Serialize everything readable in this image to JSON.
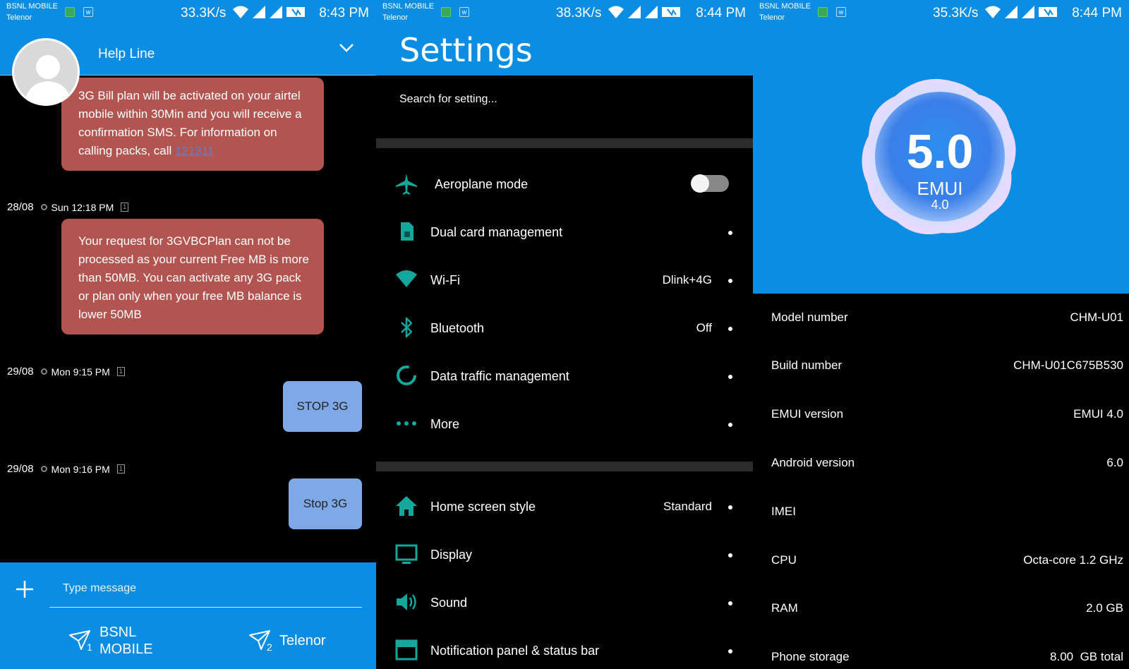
{
  "status_bars": [
    {
      "carrier1": "BSNL MOBILE",
      "carrier2": "Telenor",
      "speed": "33.3K/s",
      "time": "8:43 PM"
    },
    {
      "carrier1": "BSNL MOBILE",
      "carrier2": "Telenor",
      "speed": "38.3K/s",
      "time": "8:44 PM"
    },
    {
      "carrier1": "BSNL MOBILE",
      "carrier2": "Telenor",
      "speed": "35.3K/s",
      "time": "8:44 PM"
    }
  ],
  "chat": {
    "title": "Help Line",
    "messages": [
      {
        "text_before": "3G Bill plan will be activated on your airtel mobile within 30Min and you will receive a confirmation SMS. For information on calling packs, call ",
        "link": "121311"
      },
      {
        "text": "Your request for 3GVBCPlan can not be processed as your current Free MB is more than 50MB. You can activate any 3G pack or plan only when your free MB balance is lower 50MB"
      }
    ],
    "timestamps": [
      {
        "date": "28/08",
        "time": "Sun 12:18 PM",
        "sim": "1"
      },
      {
        "date": "29/08",
        "time": "Mon 9:15 PM",
        "sim": "1"
      },
      {
        "date": "29/08",
        "time": "Mon 9:16 PM",
        "sim": "1"
      }
    ],
    "sent": [
      "STOP 3G",
      "Stop 3G"
    ],
    "compose": {
      "placeholder": "Type message",
      "send1_sim": "1",
      "send1_label_line1": "BSNL",
      "send1_label_line2": "MOBILE",
      "send2_sim": "2",
      "send2_label": "Telenor"
    }
  },
  "settings": {
    "title": "Settings",
    "search_placeholder": "Search for setting...",
    "items": [
      {
        "label": "Aeroplane mode",
        "value": "",
        "icon": "airplane-icon"
      },
      {
        "label": "Dual card management",
        "value": "",
        "icon": "sim-card-icon"
      },
      {
        "label": "Wi-Fi",
        "value": "Dlink+4G",
        "icon": "wifi-icon"
      },
      {
        "label": "Bluetooth",
        "value": "Off",
        "icon": "bluetooth-icon"
      },
      {
        "label": "Data traffic management",
        "value": "",
        "icon": "data-usage-icon"
      },
      {
        "label": "More",
        "value": "",
        "icon": "more-dots-icon"
      },
      {
        "label": "Home screen style",
        "value": "Standard",
        "icon": "home-icon"
      },
      {
        "label": "Display",
        "value": "",
        "icon": "display-icon"
      },
      {
        "label": "Sound",
        "value": "",
        "icon": "speaker-icon"
      },
      {
        "label": "Notification panel & status bar",
        "value": "",
        "icon": "notification-panel-icon"
      }
    ],
    "accent": "#13a89e"
  },
  "about": {
    "logo_version": "5.0",
    "logo_brand": "EMUI",
    "logo_sub": "4.0",
    "rows": [
      {
        "label": "Model number",
        "value": "CHM-U01"
      },
      {
        "label": "Build number",
        "value": "CHM-U01C675B530"
      },
      {
        "label": "EMUI version",
        "value": "EMUI 4.0"
      },
      {
        "label": "Android version",
        "value": "6.0"
      },
      {
        "label": "IMEI",
        "value": ""
      },
      {
        "label": "CPU",
        "value": "Octa-core 1.2 GHz"
      },
      {
        "label": "RAM",
        "value": "2.0 GB"
      },
      {
        "label": "Phone storage",
        "value": "8.00  GB total"
      }
    ]
  },
  "colors": {
    "header_blue": "#0a8de3",
    "received_bubble": "#b25450",
    "sent_bubble": "#7fa9e6"
  }
}
